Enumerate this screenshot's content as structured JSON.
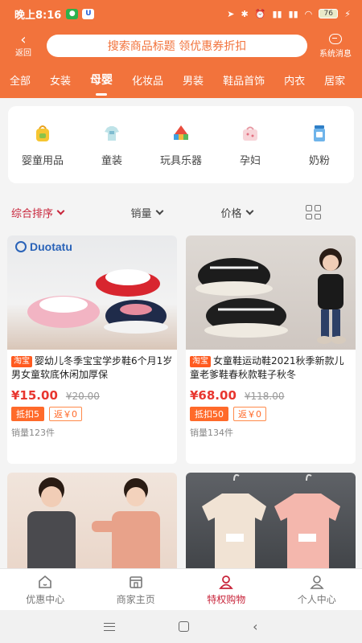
{
  "status": {
    "time": "晚上8:16",
    "battery": "76"
  },
  "header": {
    "back_label": "返回",
    "search_placeholder": "搜索商品标题 领优惠券折扣",
    "message_label": "系统消息"
  },
  "tabs": [
    "全部",
    "女装",
    "母婴",
    "化妆品",
    "男装",
    "鞋品首饰",
    "内衣",
    "居家"
  ],
  "active_tab_index": 2,
  "categories": [
    {
      "label": "婴童用品",
      "icon": "baby-bag-icon"
    },
    {
      "label": "童装",
      "icon": "kids-clothes-icon"
    },
    {
      "label": "玩具乐器",
      "icon": "toy-blocks-icon"
    },
    {
      "label": "孕妇",
      "icon": "maternity-bag-icon"
    },
    {
      "label": "奶粉",
      "icon": "milk-powder-icon"
    }
  ],
  "sort": {
    "overall": "综合排序",
    "sales": "销量",
    "price": "价格"
  },
  "products": [
    {
      "brand": "Duotatu",
      "source": "淘宝",
      "title": "婴幼儿冬季宝宝学步鞋6个月1岁男女童软底休闲加厚保",
      "price": "¥15.00",
      "original_price": "¥20.00",
      "discount": "抵扣5",
      "rebate": "返￥0",
      "sold": "销量123件"
    },
    {
      "source": "淘宝",
      "title": "女童鞋运动鞋2021秋季新款儿童老爹鞋春秋款鞋子秋冬",
      "price": "¥68.00",
      "original_price": "¥118.00",
      "discount": "抵扣50",
      "rebate": "返￥0",
      "sold": "销量134件"
    }
  ],
  "bottom_nav": [
    "优惠中心",
    "商家主页",
    "特权购物",
    "个人中心"
  ],
  "active_bottom_index": 2,
  "colors": {
    "brand_orange": "#f2733c",
    "accent_red": "#c8243a",
    "price_red": "#e8362f"
  }
}
